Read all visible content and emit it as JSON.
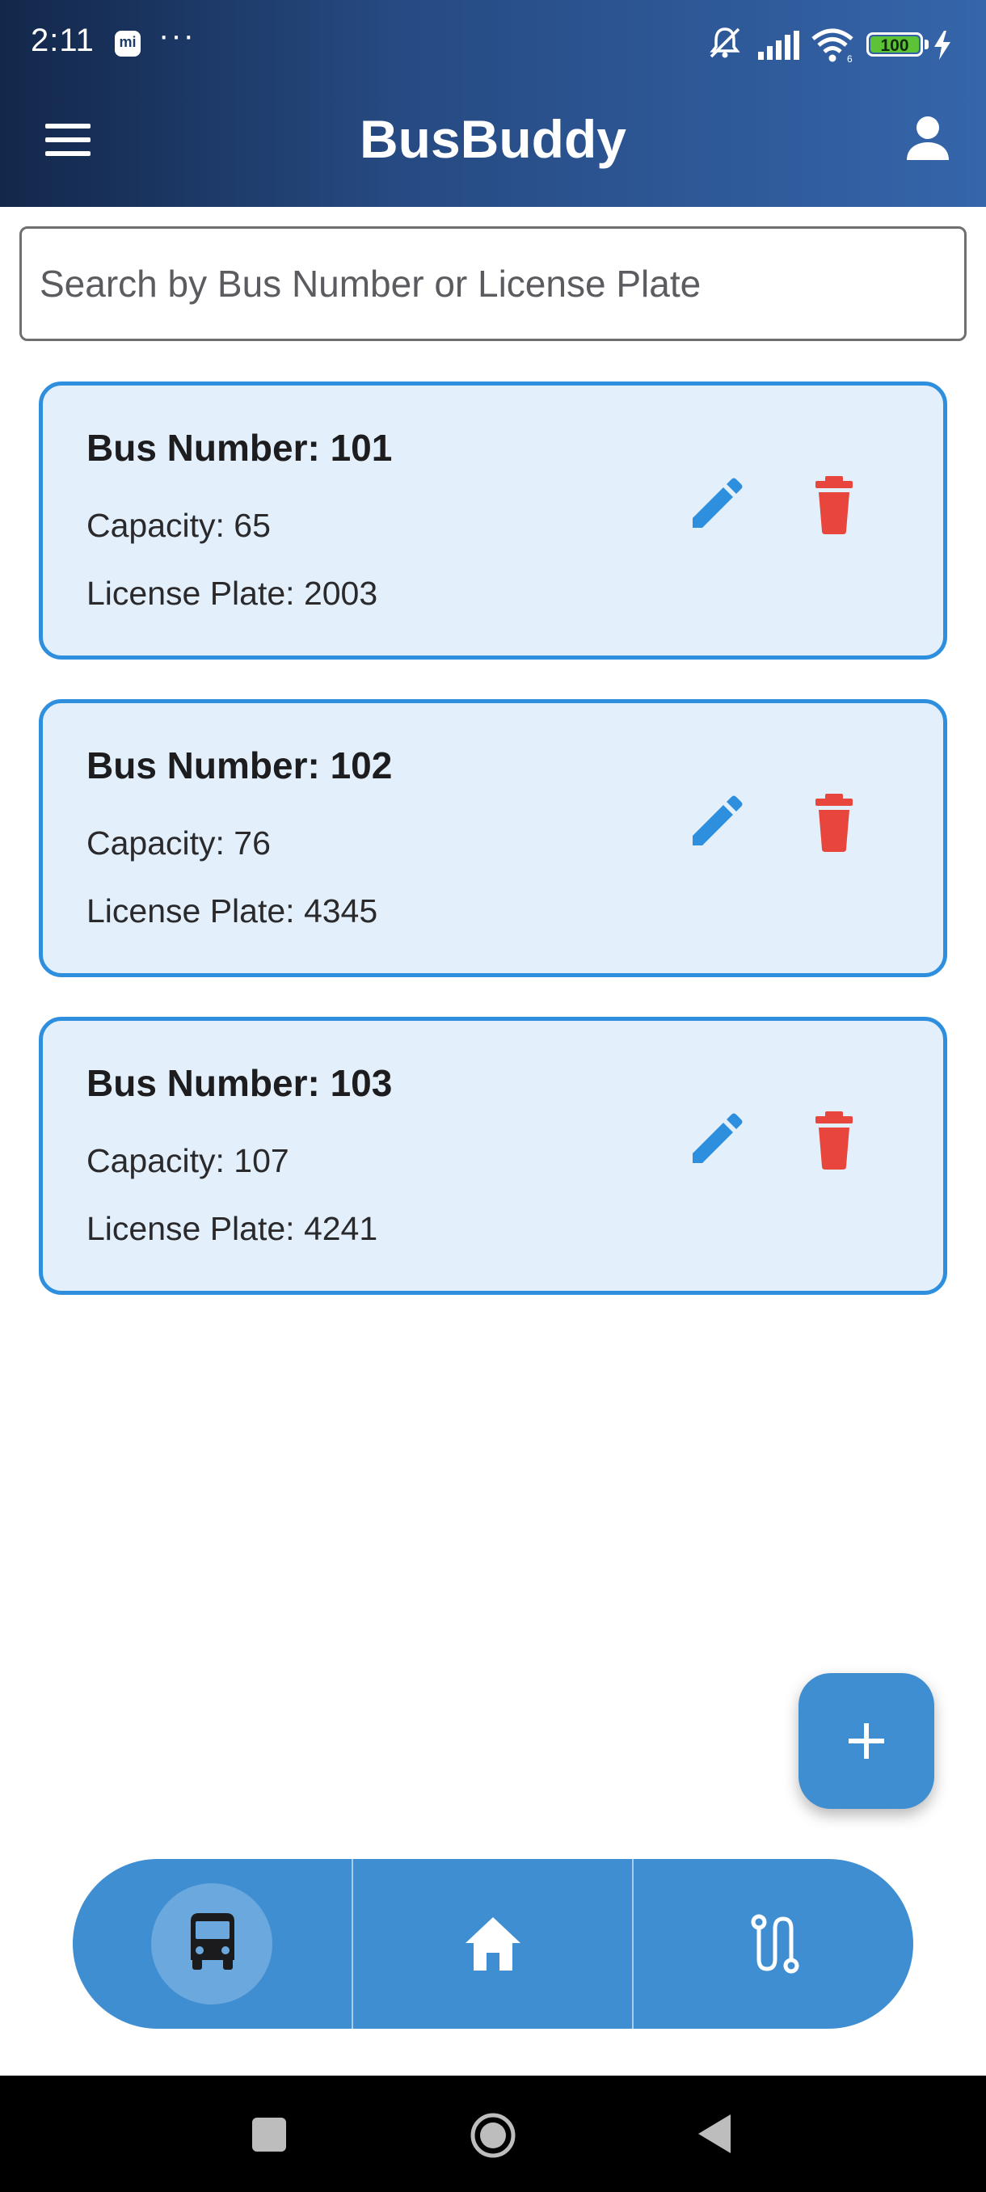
{
  "status_bar": {
    "time": "2:11",
    "more_indicator": "···",
    "battery_level": "100",
    "icons": [
      "mi-notification-icon",
      "mute-icon",
      "signal-icon",
      "wifi-icon",
      "battery-icon",
      "charging-icon"
    ]
  },
  "app_bar": {
    "title": "BusBuddy",
    "left_icon": "menu-icon",
    "right_icon": "account-icon"
  },
  "search": {
    "placeholder": "Search by Bus Number or License Plate",
    "value": ""
  },
  "buses": [
    {
      "number": "Bus Number: 101",
      "capacity": "Capacity: 65",
      "plate": "License Plate: 2003"
    },
    {
      "number": "Bus Number: 102",
      "capacity": "Capacity: 76",
      "plate": "License Plate: 4345"
    },
    {
      "number": "Bus Number: 103",
      "capacity": "Capacity: 107",
      "plate": "License Plate: 4241"
    }
  ],
  "card_actions": {
    "edit_icon": "pencil-icon",
    "delete_icon": "trash-icon"
  },
  "fab": {
    "icon": "plus-icon"
  },
  "bottom_nav": {
    "items": [
      {
        "icon": "bus-icon",
        "active": true
      },
      {
        "icon": "home-icon",
        "active": false
      },
      {
        "icon": "route-icon",
        "active": false
      }
    ]
  },
  "colors": {
    "app_bar_start": "#13274a",
    "app_bar_end": "#3565aa",
    "card_background": "#e3effa",
    "card_border": "#2f8fdf",
    "edit_icon": "#2f8fdf",
    "delete_icon": "#e8453c",
    "accent": "#3f8ed2"
  }
}
